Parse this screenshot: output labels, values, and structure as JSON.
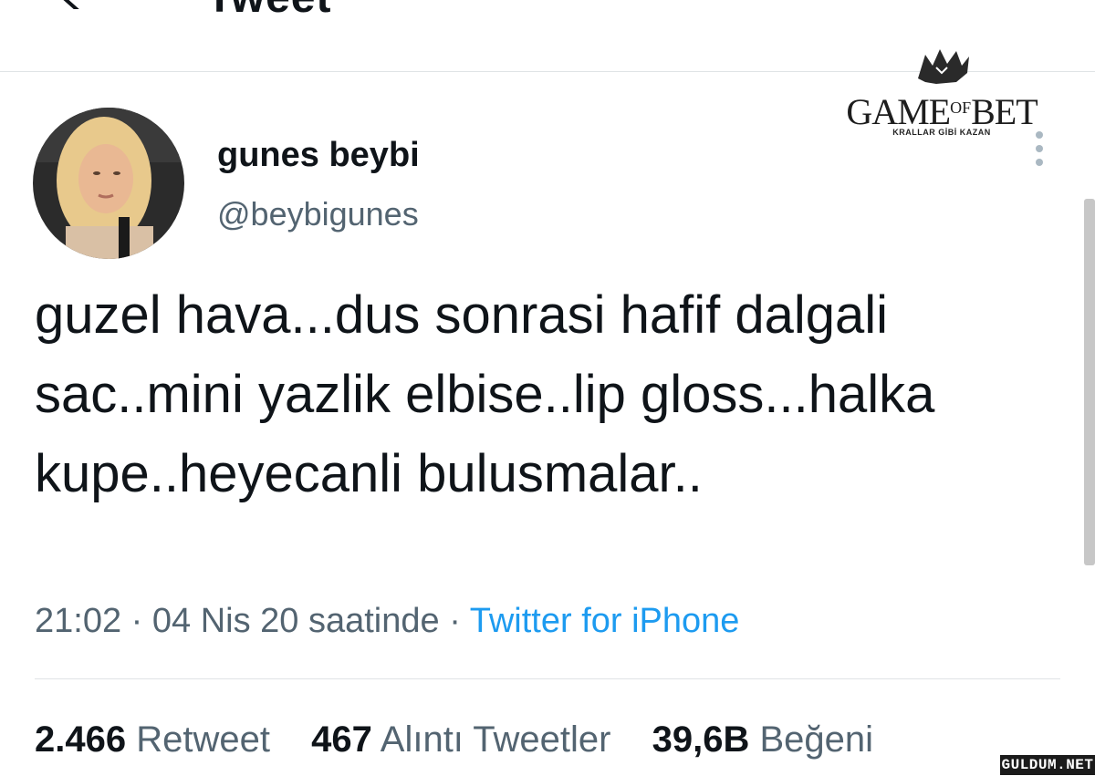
{
  "header": {
    "title": "Tweet",
    "back_icon": "arrow-left-icon"
  },
  "tweet": {
    "display_name": "gunes beybi",
    "handle": "@beybigunes",
    "text": "guzel hava...dus sonrasi hafif dalgali sac..mini yazlik elbise..lip gloss...halka kupe..heyecanli bulusmalar..",
    "time": "21:02",
    "date": "04 Nis 20 saatinde",
    "source": "Twitter for iPhone",
    "more_icon": "more-vertical-icon"
  },
  "stats": {
    "retweets_count": "2.466",
    "retweets_label": "Retweet",
    "quotes_count": "467",
    "quotes_label": "Alıntı Tweetler",
    "likes_count": "39,6B",
    "likes_label": "Beğeni"
  },
  "overlay_logo": {
    "text_main_1": "GAME",
    "text_of": "OF",
    "text_main_2": "BET",
    "tagline": "KRALLAR GİBİ KAZAN"
  },
  "watermark": "GULDUM.NET",
  "colors": {
    "link": "#1d9bf0",
    "secondary": "#536471",
    "primary_text": "#0f1419",
    "divider": "#dfe3e6"
  }
}
